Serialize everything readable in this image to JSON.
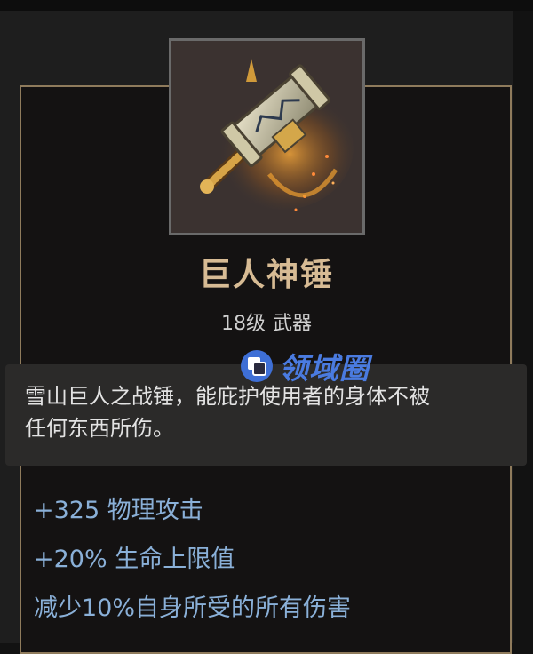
{
  "item": {
    "name": "巨人神锤",
    "level": "18级",
    "category": "武器",
    "description_lines": [
      "雪山巨人之战锤，能庇护使用者的身体不被",
      "任何东西所伤。"
    ],
    "stats": [
      "+325 物理攻击",
      "+20% 生命上限值",
      "减少10%自身所受的所有伤害"
    ],
    "icon": "war-hammer-icon"
  },
  "watermark": {
    "text": "领域圈",
    "icon": "square-logo-icon"
  },
  "colors": {
    "name": "#d7bb94",
    "stat": "#8ab0d8",
    "frame_border": "#8f7b5c",
    "watermark": "#4a7be0"
  }
}
